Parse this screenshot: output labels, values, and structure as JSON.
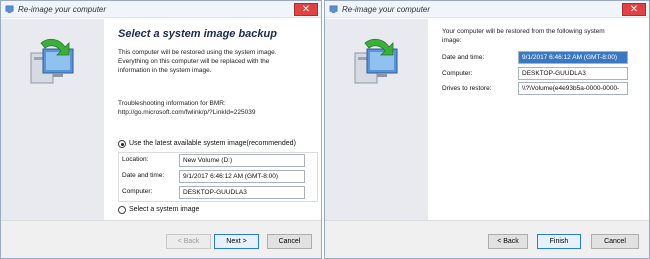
{
  "window1": {
    "title": "Re-image your computer",
    "close_glyph": "✕",
    "heading": "Select a system image backup",
    "description_lines": [
      "This computer will be restored using the system image.",
      "Everything on this computer will be replaced with the",
      "information in the system image."
    ],
    "troubleshoot_lines": [
      "Troubleshooting information for BMR:",
      "http://go.microsoft.com/fwlink/p/?LinkId=225039"
    ],
    "option_latest": "Use the latest available system image(recommended)",
    "location_label": "Location:",
    "location_value": "New Volume (D:)",
    "datetime_label": "Date and time:",
    "datetime_value": "9/1/2017 6:46:12 AM (GMT-8:00)",
    "computer_label": "Computer:",
    "computer_value": "DESKTOP-GUUDLA3",
    "option_select": "Select a system image",
    "back_label": "< Back",
    "next_label": "Next >",
    "cancel_label": "Cancel"
  },
  "window2": {
    "title": "Re-image your computer",
    "close_glyph": "✕",
    "intro_lines": [
      "Your computer will be restored from the following system",
      "image:"
    ],
    "datetime_label": "Date and time:",
    "datetime_value": "9/1/2017 6:46:12 AM (GMT-8:00)",
    "computer_label": "Computer:",
    "computer_value": "DESKTOP-GUUDLA3",
    "drives_label": "Drives to restore:",
    "drives_value": "\\\\?\\Volume{e4e93b5a-0000-0000-",
    "back_label": "< Back",
    "finish_label": "Finish",
    "cancel_label": "Cancel"
  },
  "colors": {
    "accent": "#2a7ad6",
    "close": "#e04343",
    "sidebar": "#e9eaf0",
    "selection": "#3b78c2"
  },
  "icons": [
    "window-app-icon",
    "restore-computer-icon",
    "close-icon"
  ]
}
